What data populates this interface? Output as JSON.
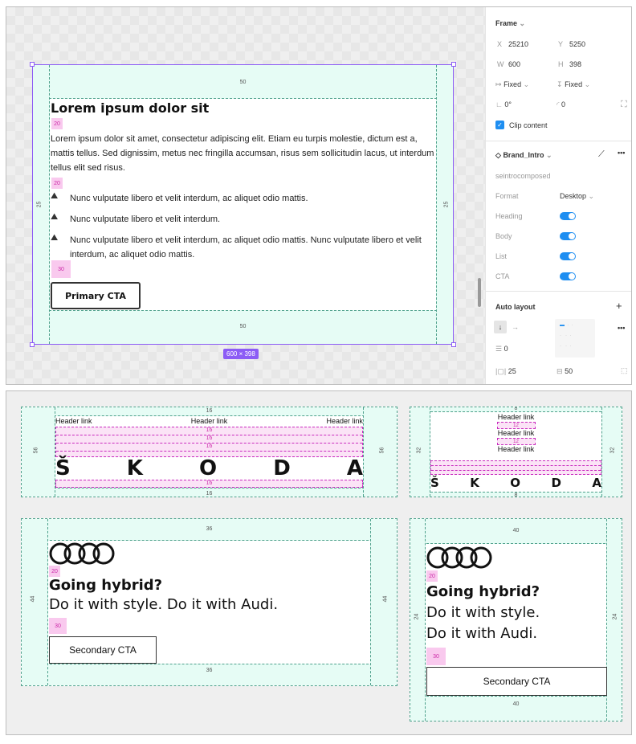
{
  "editor": {
    "frame_size_badge": "600 × 398",
    "spacing_top": "50",
    "spacing_bottom": "50",
    "spacing_left": "25",
    "spacing_right": "25",
    "gap_heading": "20",
    "gap_body": "20",
    "gap_list": "30",
    "heading": "Lorem ipsum dolor sit",
    "body": "Lorem ipsum dolor sit amet, consectetur adipiscing elit. Etiam eu turpis molestie, dictum est a, mattis tellus. Sed dignissim, metus nec fringilla accumsan, risus sem sollicitudin lacus, ut interdum tellus elit sed risus.",
    "list": [
      "Nunc vulputate libero et velit interdum, ac aliquet odio mattis.",
      "Nunc vulputate libero et velit interdum.",
      "Nunc vulputate libero et velit interdum, ac aliquet odio mattis. Nunc vulputate libero et velit interdum, ac aliquet odio mattis."
    ],
    "cta": "Primary CTA"
  },
  "properties": {
    "frame_label": "Frame",
    "x_label": "X",
    "x_value": "25210",
    "y_label": "Y",
    "y_value": "5250",
    "w_label": "W",
    "w_value": "600",
    "h_label": "H",
    "h_value": "398",
    "width_mode": "Fixed",
    "height_mode": "Fixed",
    "rotation": "0°",
    "radius": "0",
    "clip_content": "Clip content",
    "component_name": "Brand_Intro",
    "component_subname": "seintrocomposed",
    "format_label": "Format",
    "format_value": "Desktop",
    "toggles": [
      {
        "label": "Heading",
        "on": true
      },
      {
        "label": "Body",
        "on": true
      },
      {
        "label": "List",
        "on": true
      },
      {
        "label": "CTA",
        "on": true
      }
    ],
    "auto_layout_label": "Auto layout",
    "gap_value": "0",
    "padding_h": "25",
    "padding_v": "50"
  },
  "skoda_wide": {
    "top": "16",
    "bottom": "16",
    "side": "56",
    "gaps": [
      "16",
      "16",
      "16",
      "16"
    ],
    "links": [
      "Header link",
      "Header link",
      "Header link"
    ],
    "letters": [
      "Š",
      "K",
      "O",
      "D",
      "A"
    ]
  },
  "skoda_narrow": {
    "top": "8",
    "bottom": "8",
    "side": "32",
    "gaps": [
      "12",
      "12"
    ],
    "links": [
      "Header link",
      "Header link",
      "Header link"
    ],
    "letters": [
      "Š",
      "K",
      "O",
      "D",
      "A"
    ]
  },
  "audi_wide": {
    "top": "36",
    "bottom": "36",
    "side": "44",
    "gap1": "20",
    "gap2": "30",
    "heading": "Going hybrid?",
    "sub": "Do it with style. Do it with Audi.",
    "cta": "Secondary CTA"
  },
  "audi_narrow": {
    "top": "40",
    "bottom": "40",
    "side": "24",
    "gap1": "20",
    "gap2": "30",
    "heading": "Going hybrid?",
    "sub1": "Do it with style.",
    "sub2": "Do it with Audi.",
    "cta": "Secondary CTA"
  },
  "colors": {
    "selection": "#8c5cf5",
    "padding_fill": "#e6fcf5",
    "gap_fill": "#f9c9ee",
    "toggle": "#1e8ef1"
  }
}
